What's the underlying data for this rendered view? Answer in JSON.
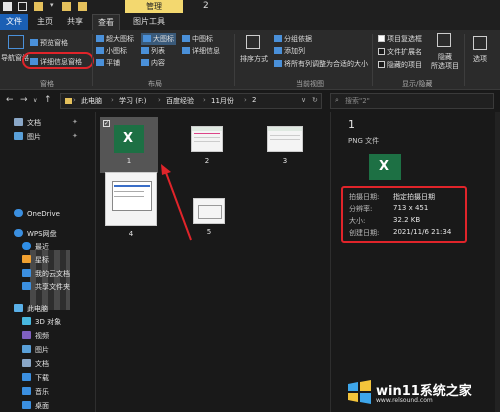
{
  "titlebar": {
    "manage_tab": "管理",
    "window_title": "2"
  },
  "ribbon_tabs": [
    "文件",
    "主页",
    "共享",
    "查看",
    "图片工具"
  ],
  "ribbon": {
    "nav_pane": "导航窗格",
    "preview_pane": "预览窗格",
    "details_pane": "详细信息窗格",
    "pane_group": "窗格",
    "layout_items": [
      "超大图标",
      "大图标",
      "中图标",
      "小图标",
      "列表",
      "详细信息",
      "平铺",
      "内容"
    ],
    "layout_group": "布局",
    "sort_by": "排序方式",
    "group_by": "分组依据",
    "add_column": "添加列",
    "fit_columns": "将所有列调整为合适的大小",
    "current_view_group": "当前视图",
    "item_checkboxes": "项目复选框",
    "file_extensions": "文件扩展名",
    "hidden_items": "隐藏的项目",
    "hide_selected": "隐藏",
    "hide_selected2": "所选项目",
    "show_hide_group": "显示/隐藏",
    "options": "选项"
  },
  "address": {
    "crumbs": [
      "此电脑",
      "学习 (F:)",
      "百度经验",
      "11月份",
      "2"
    ],
    "search_placeholder": "搜索\"2\""
  },
  "sidebar": {
    "items": [
      "文档",
      "图片",
      "OneDrive",
      "WPS网盘",
      "最近",
      "星标",
      "我的云文档",
      "共享文件夹",
      "此电脑",
      "3D 对象",
      "视频",
      "图片",
      "文档",
      "下载",
      "音乐",
      "桌面"
    ]
  },
  "files": [
    {
      "name": "1"
    },
    {
      "name": "2"
    },
    {
      "name": "3"
    },
    {
      "name": "4"
    },
    {
      "name": "5"
    }
  ],
  "details": {
    "name": "1",
    "type": "PNG 文件",
    "rows": [
      {
        "label": "拍摄日期:",
        "value": "指定拍摄日期"
      },
      {
        "label": "分辨率:",
        "value": "713 x 451"
      },
      {
        "label": "大小:",
        "value": "32.2 KB"
      },
      {
        "label": "创建日期:",
        "value": "2021/11/6 21:34"
      }
    ]
  },
  "watermark": {
    "brand": "win11系统之家",
    "url": "www.relsound.com"
  },
  "colors": {
    "accent": "#1a5fb4",
    "excel_green": "#1d7044",
    "highlight_red": "#e0242a"
  }
}
